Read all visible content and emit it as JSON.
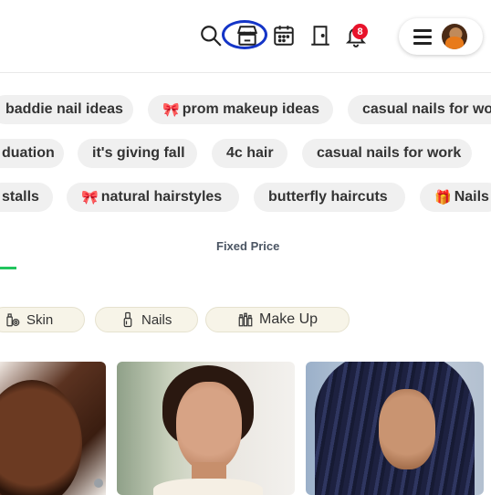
{
  "header": {
    "notification_count": "8",
    "icons": [
      "search-icon",
      "store-icon",
      "calendar-icon",
      "door-icon",
      "bell-icon",
      "menu-icon"
    ]
  },
  "tags": {
    "row1": [
      {
        "label": "baddie nail ideas",
        "emoji": ""
      },
      {
        "label": "prom makeup ideas",
        "emoji": "🎀"
      },
      {
        "label": "casual nails for wo",
        "emoji": ""
      }
    ],
    "row2": [
      {
        "label": "duation",
        "emoji": ""
      },
      {
        "label": "it's giving fall",
        "emoji": ""
      },
      {
        "label": "4c hair",
        "emoji": ""
      },
      {
        "label": "casual nails for work",
        "emoji": ""
      }
    ],
    "row3": [
      {
        "label": "stalls",
        "emoji": ""
      },
      {
        "label": "natural hairstyles",
        "emoji": "🎀"
      },
      {
        "label": "butterfly haircuts",
        "emoji": ""
      },
      {
        "label": "Nails",
        "emoji": "🎁"
      }
    ]
  },
  "filter": {
    "label": "Fixed Price"
  },
  "categories": [
    {
      "label": "Skin",
      "icon": "skincare-icon"
    },
    {
      "label": "Nails",
      "icon": "nail-polish-icon"
    },
    {
      "label": "Make Up",
      "icon": "makeup-icon"
    }
  ],
  "colors": {
    "highlight_ring": "#1435c7",
    "badge": "#e8132b",
    "active_underline": "#22c55e",
    "chip_bg": "#f0f0f0",
    "category_bg": "#f7f4e8"
  }
}
